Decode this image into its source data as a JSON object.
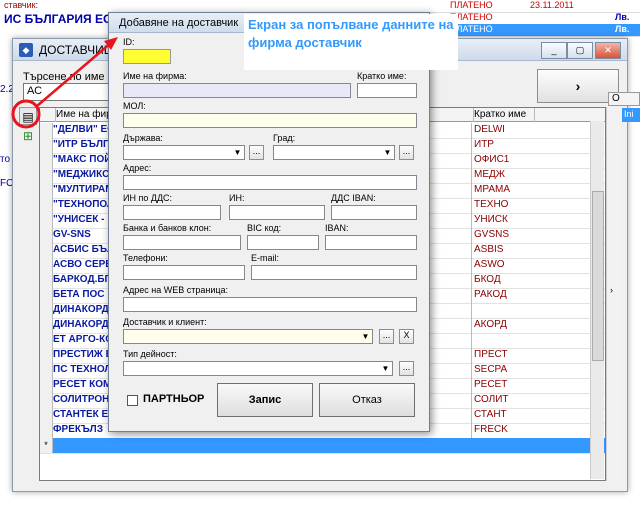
{
  "background": {
    "company_name": "ИС БЪЛГАРИЯ ЕООД",
    "top_label": "ставчик:",
    "side_labels": [
      "2.2",
      "то",
      "FO"
    ],
    "rows": [
      {
        "status": "ПЛАТЕНО",
        "date": "23.11.2011",
        "cur": ""
      },
      {
        "status": "ПЛАТЕНО",
        "date": "",
        "cur": "Лв."
      },
      {
        "status": "ПЛАТЕНО",
        "date": "",
        "cur": "Лв."
      }
    ],
    "right_header": "О",
    "right_cell": "Ini"
  },
  "window": {
    "title": "ДОСТАВЧИЦИ",
    "search_label": "Търсене по име на ф",
    "search_value": "АС",
    "nav_button_label": "›",
    "buttons": [
      "_",
      "▢",
      "✕"
    ]
  },
  "grid": {
    "headers": {
      "name": "Име на фирма",
      "code": "Кратко име"
    },
    "rows": [
      {
        "name": "\"ДЕЛВИ\" ЕО",
        "code": "DELWI"
      },
      {
        "name": "\"ИТР БЪЛГА",
        "code": "ИТР"
      },
      {
        "name": "\"МАКС ПОЙ",
        "code": "ОФИС1"
      },
      {
        "name": "\"МЕДЖИКС",
        "code": "МЕДЖ"
      },
      {
        "name": "\"МУЛТИРАМ",
        "code": "МРАМА"
      },
      {
        "name": "\"ТЕХНОПОЛ",
        "code": "ТЕХНО"
      },
      {
        "name": "\"УНИСЕК - ",
        "code": "УНИСК"
      },
      {
        "name": "GV-SNS",
        "code": "GVSNS"
      },
      {
        "name": "АСБИС БЪЛ",
        "code": "ASBIS"
      },
      {
        "name": "АСВО СЕРВ",
        "code": "ASWO"
      },
      {
        "name": "БАРКОД.БГ",
        "code": "БКОД"
      },
      {
        "name": "БЕТА ПОС ",
        "code": "РАКОД"
      },
      {
        "name": "ДИНАКОРД",
        "code": ""
      },
      {
        "name": "ДИНАКОРД",
        "code": "АКОРД"
      },
      {
        "name": "ЕТ АРГО-КО",
        "code": ""
      },
      {
        "name": "ПРЕСТИЖ Е",
        "code": "ПРЕСТ"
      },
      {
        "name": "ПС ТЕХНОЛ",
        "code": "SECPA"
      },
      {
        "name": "РЕСЕТ КОМ",
        "code": "РЕСЕТ"
      },
      {
        "name": "СОЛИТРОН",
        "code": "СОЛИТ"
      },
      {
        "name": "СТАНТЕК Е",
        "code": "СТАНТ"
      },
      {
        "name": "ФРЕКЪЛЗ",
        "code": "FRECK"
      }
    ],
    "new_row_marker": "*"
  },
  "dialog": {
    "title": "Добавяне на доставчик",
    "id_label": "ID:",
    "company_name_label": "Име на фирма:",
    "short_name_label": "Кратко име:",
    "mol_label": "МОЛ:",
    "country_label": "Държава:",
    "city_label": "Град:",
    "address_label": "Адрес:",
    "vat_label": "ИН по ДДС:",
    "in_label": "ИН:",
    "vat_iban_label": "ДДС IBAN:",
    "bank_label": "Банка и банков клон:",
    "bic_label": "BIC код:",
    "iban_label": "IBAN:",
    "phones_label": "Телефони:",
    "email_label": "E-mail:",
    "web_label": "Адрес на WEB страница:",
    "supplier_client_label": "Доставчик и клиент:",
    "activity_label": "Тип дейност:",
    "partner_label": "ПАРТНЬОР",
    "save_label": "Запис",
    "cancel_label": "Отказ",
    "dots_label": "...",
    "clear_label": "X"
  },
  "annotation": {
    "text": "Екран за попълване данните на фирма доставчик",
    "color": "#3399ff",
    "arrow_color": "#e8141e"
  }
}
